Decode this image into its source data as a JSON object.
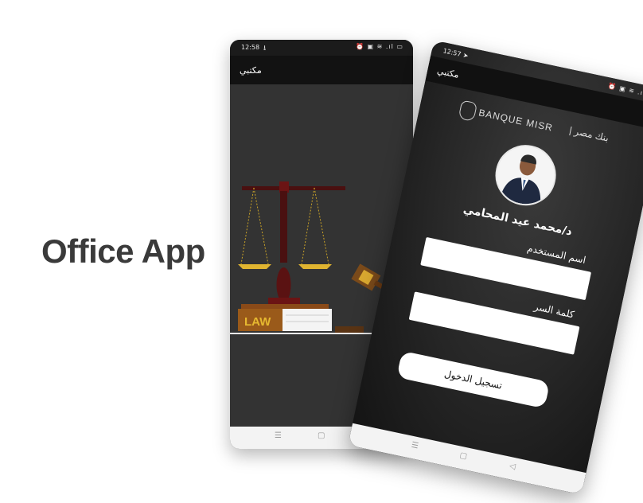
{
  "headline": "Office App",
  "phone1": {
    "status": {
      "time": "12:58",
      "download_glyph": "⭳",
      "icons": "⏰ ▣ ≋ .ıl ▭"
    },
    "app_title": "مكتبي",
    "illustration": {
      "book_label": "LAW"
    },
    "nav": {
      "menu": "☰",
      "home": "▢",
      "back": "◁"
    }
  },
  "phone2": {
    "status": {
      "time": "12:57 ➤",
      "icons": "⏰ ▣ ≋ .ıl ▭"
    },
    "app_title": "مكتبي",
    "bank": {
      "latin": "BANQUE MISR",
      "arabic": "| بنك مصر"
    },
    "user_name": "د/محمد عيد المحامي",
    "username_label": "اسم المستخدم",
    "password_label": "كلمة السر",
    "login_label": "تسجيل الدخول",
    "nav": {
      "menu": "☰",
      "home": "▢",
      "back": "◁"
    }
  }
}
